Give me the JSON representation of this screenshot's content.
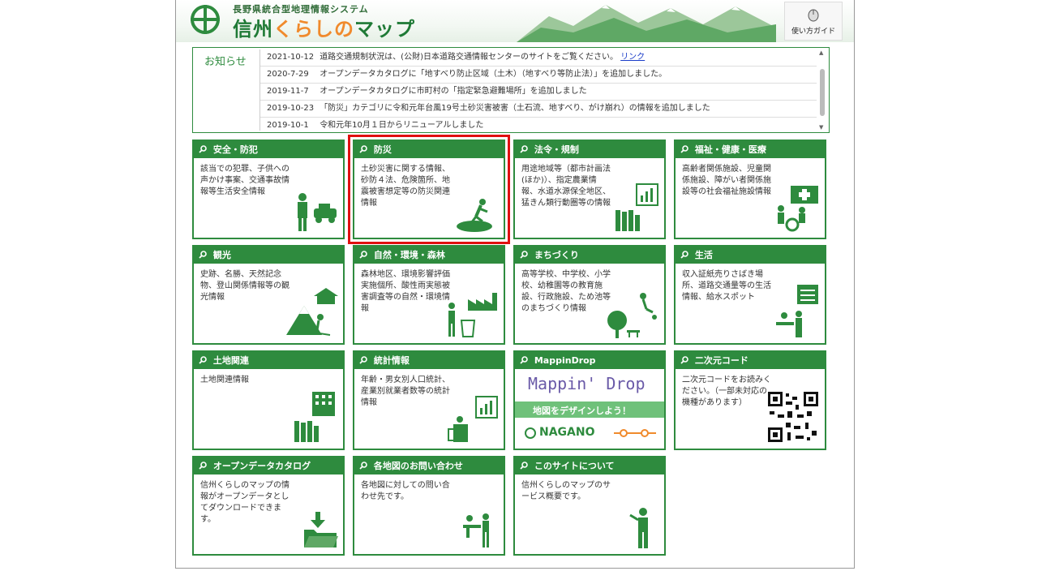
{
  "header": {
    "subtitle": "長野県統合型地理情報システム",
    "title_prefix": "信州",
    "title_kana": "くらしの",
    "title_suffix": "マップ",
    "guide_label": "使い方ガイド"
  },
  "news": {
    "title": "お知らせ",
    "items": [
      {
        "date": "2021-10-12",
        "text": "道路交通規制状況は、(公財)日本道路交通情報センターのサイトをご覧ください。",
        "link": "リンク"
      },
      {
        "date": "2020-7-29",
        "text": "オープンデータカタログに「地すべり防止区域（土木）（地すべり等防止法）」を追加しました。"
      },
      {
        "date": "2019-11-7",
        "text": "オープンデータカタログに市町村の「指定緊急避難場所」を追加しました"
      },
      {
        "date": "2019-10-23",
        "text": "「防災」カテゴリに令和元年台風19号土砂災害被害（土石流、地すべり、がけ崩れ）の情報を追加しました"
      },
      {
        "date": "2019-10-1",
        "text": "令和元年10月１日からリニューアルしました"
      }
    ]
  },
  "tiles": [
    {
      "title": "安全・防犯",
      "desc": "該当での犯罪、子供への声かけ事案、交通事故情報等生活安全情報"
    },
    {
      "title": "防災",
      "desc": "土砂災害に関する情報、砂防４法、危険箇所、地震被害想定等の防災関連情報"
    },
    {
      "title": "法令・規制",
      "desc": "用途地域等（都市計画法(ほか)）、指定農業情報、水道水源保全地区、猛きん類行動圏等の情報"
    },
    {
      "title": "福祉・健康・医療",
      "desc": "高齢者関係施設、児童関係施設、障がい者関係施設等の社会福祉施設情報"
    },
    {
      "title": "観光",
      "desc": "史跡、名勝、天然記念物、登山関係情報等の観光情報"
    },
    {
      "title": "自然・環境・森林",
      "desc": "森林地区、環境影響評価実施個所、酸性雨実態被害調査等の自然・環境情報"
    },
    {
      "title": "まちづくり",
      "desc": "高等学校、中学校、小学校、幼稚園等の教育施設、行政施設、ため池等のまちづくり情報"
    },
    {
      "title": "生活",
      "desc": "収入証紙売りさばき場所、道路交通量等の生活情報、給水スポット"
    },
    {
      "title": "土地関連",
      "desc": "土地関連情報"
    },
    {
      "title": "統計情報",
      "desc": "年齢・男女別人口統計、産業別就業者数等の統計情報"
    },
    {
      "title": "MappinDrop",
      "desc": "",
      "banner_title": "Mappin' Drop",
      "banner_sub": "地図をデザインしよう！",
      "banner_place": "NAGANO"
    },
    {
      "title": "二次元コード",
      "desc": "二次元コードをお読みください。（一部未対応の機種があります）"
    },
    {
      "title": "オープンデータカタログ",
      "desc": "信州くらしのマップの情報がオープンデータとしてダウンロードできます。"
    },
    {
      "title": "各地図のお問い合わせ",
      "desc": "各地図に対しての問い合わせ先です。"
    },
    {
      "title": "このサイトについて",
      "desc": "信州くらしのマップのサービス概要です。"
    }
  ],
  "colors": {
    "accent": "#2e8b3e",
    "title_kana": "#f08a2c",
    "selection": "#e01010",
    "link": "#1a3cc8"
  }
}
